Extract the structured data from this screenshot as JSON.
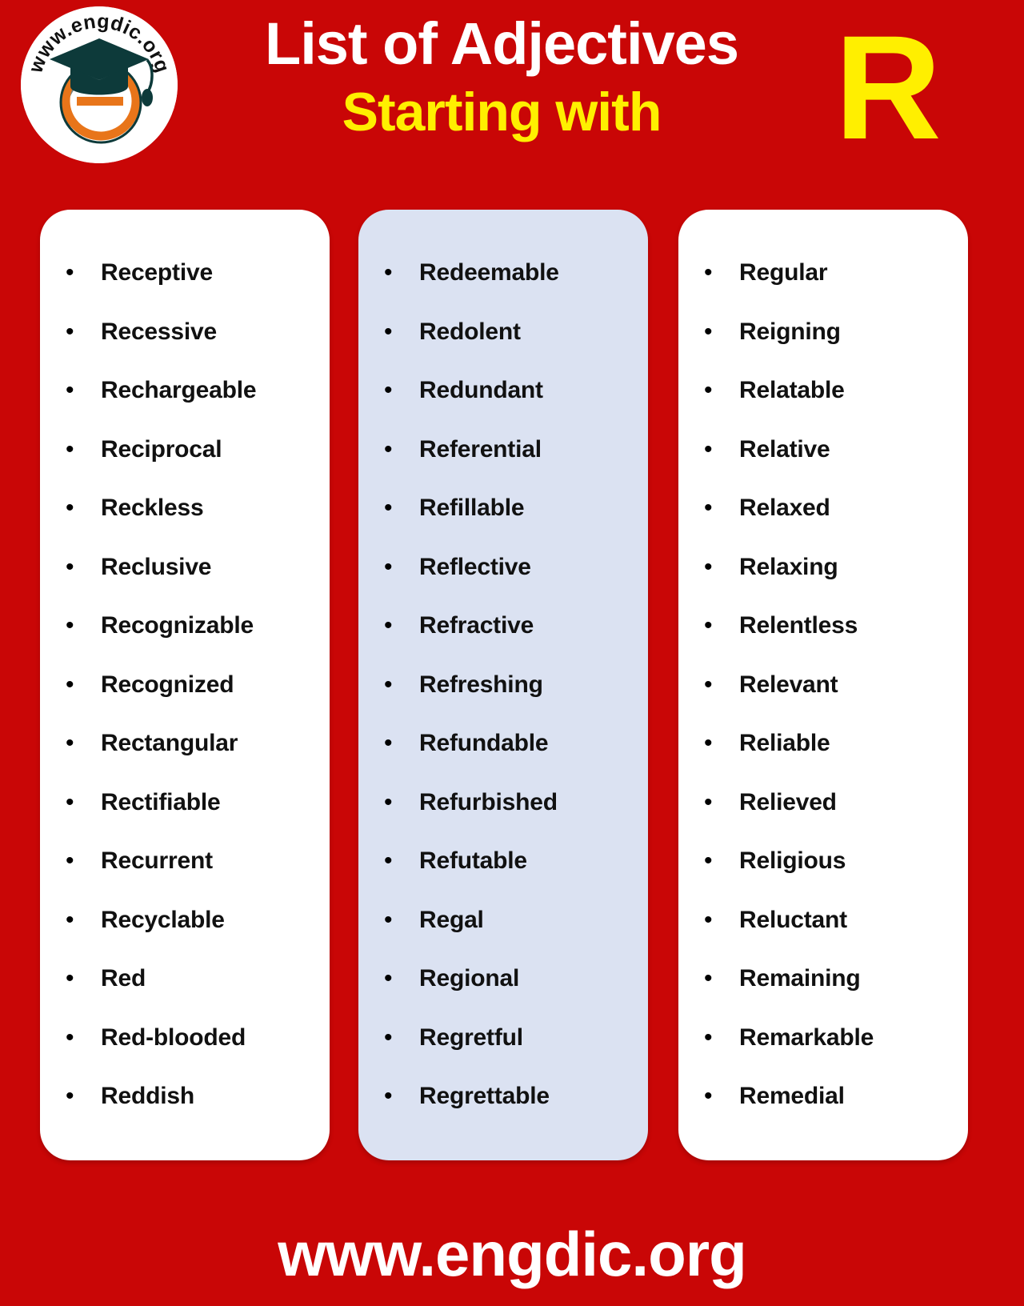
{
  "page": {
    "background_color": "#c90606",
    "accent_yellow": "#ffef00"
  },
  "header": {
    "logo": {
      "icon_name": "engdic-graduation-cap-logo",
      "circular_text": "www.engdic.org",
      "cap_color": "#0d3a3a",
      "letter_color": "#e8751a",
      "letter": "e"
    },
    "title_line1": "List of Adjectives",
    "title_line2": "Starting with",
    "letter_badge": "R"
  },
  "columns": [
    {
      "card_name": "column-one",
      "background_color": "#ffffff",
      "words": [
        "Receptive",
        "Recessive",
        "Rechargeable",
        "Reciprocal",
        "Reckless",
        "Reclusive",
        "Recognizable",
        "Recognized",
        "Rectangular",
        "Rectifiable",
        "Recurrent",
        "Recyclable",
        "Red",
        "Red-blooded",
        "Reddish"
      ]
    },
    {
      "card_name": "column-two",
      "background_color": "#dbe2f2",
      "words": [
        "Redeemable",
        "Redolent",
        "Redundant",
        "Referential",
        "Refillable",
        "Reflective",
        "Refractive",
        "Refreshing",
        "Refundable",
        "Refurbished",
        "Refutable",
        "Regal",
        "Regional",
        "Regretful",
        "Regrettable"
      ]
    },
    {
      "card_name": "column-three",
      "background_color": "#ffffff",
      "words": [
        "Regular",
        "Reigning",
        "Relatable",
        "Relative",
        "Relaxed",
        "Relaxing",
        "Relentless",
        "Relevant",
        "Reliable",
        "Relieved",
        "Religious",
        "Reluctant",
        "Remaining",
        "Remarkable",
        "Remedial"
      ]
    }
  ],
  "footer": {
    "website": "www.engdic.org"
  }
}
